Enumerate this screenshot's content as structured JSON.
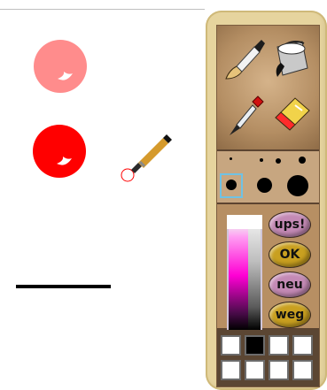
{
  "colors": {
    "light_red": "#ff8c8c",
    "red": "#ff0000",
    "line": "#000000",
    "palette_bg": "#e6d49e",
    "selected_box": "#6fc2e4"
  },
  "canvas": {
    "strokes": [
      {
        "name": "light-red-dot",
        "icon": "dot-with-highlight"
      },
      {
        "name": "red-dot",
        "icon": "dot-with-highlight"
      },
      {
        "name": "brush-cursor",
        "icon": "paintbrush-icon"
      },
      {
        "name": "black-line",
        "icon": "line"
      }
    ]
  },
  "palette": {
    "tools": [
      {
        "name": "paintbrush",
        "icon": "paintbrush-icon"
      },
      {
        "name": "paint-bucket",
        "icon": "paint-bucket-icon"
      },
      {
        "name": "eyedropper",
        "icon": "eyedropper-icon"
      },
      {
        "name": "eraser",
        "icon": "eraser-icon"
      }
    ],
    "brush_sizes": [
      "size-1",
      "size-2",
      "size-3",
      "size-4",
      "size-5",
      "size-6",
      "size-7"
    ],
    "selected_brush_size": "size-5",
    "buttons": {
      "undo": "ups!",
      "ok": "OK",
      "new": "neu",
      "remove": "weg"
    },
    "swatch_colors": [
      "#ffffff",
      "#000000",
      "#ffffff",
      "#ffffff",
      "#ffffff",
      "#ffffff",
      "#ffffff",
      "#ffffff"
    ]
  }
}
